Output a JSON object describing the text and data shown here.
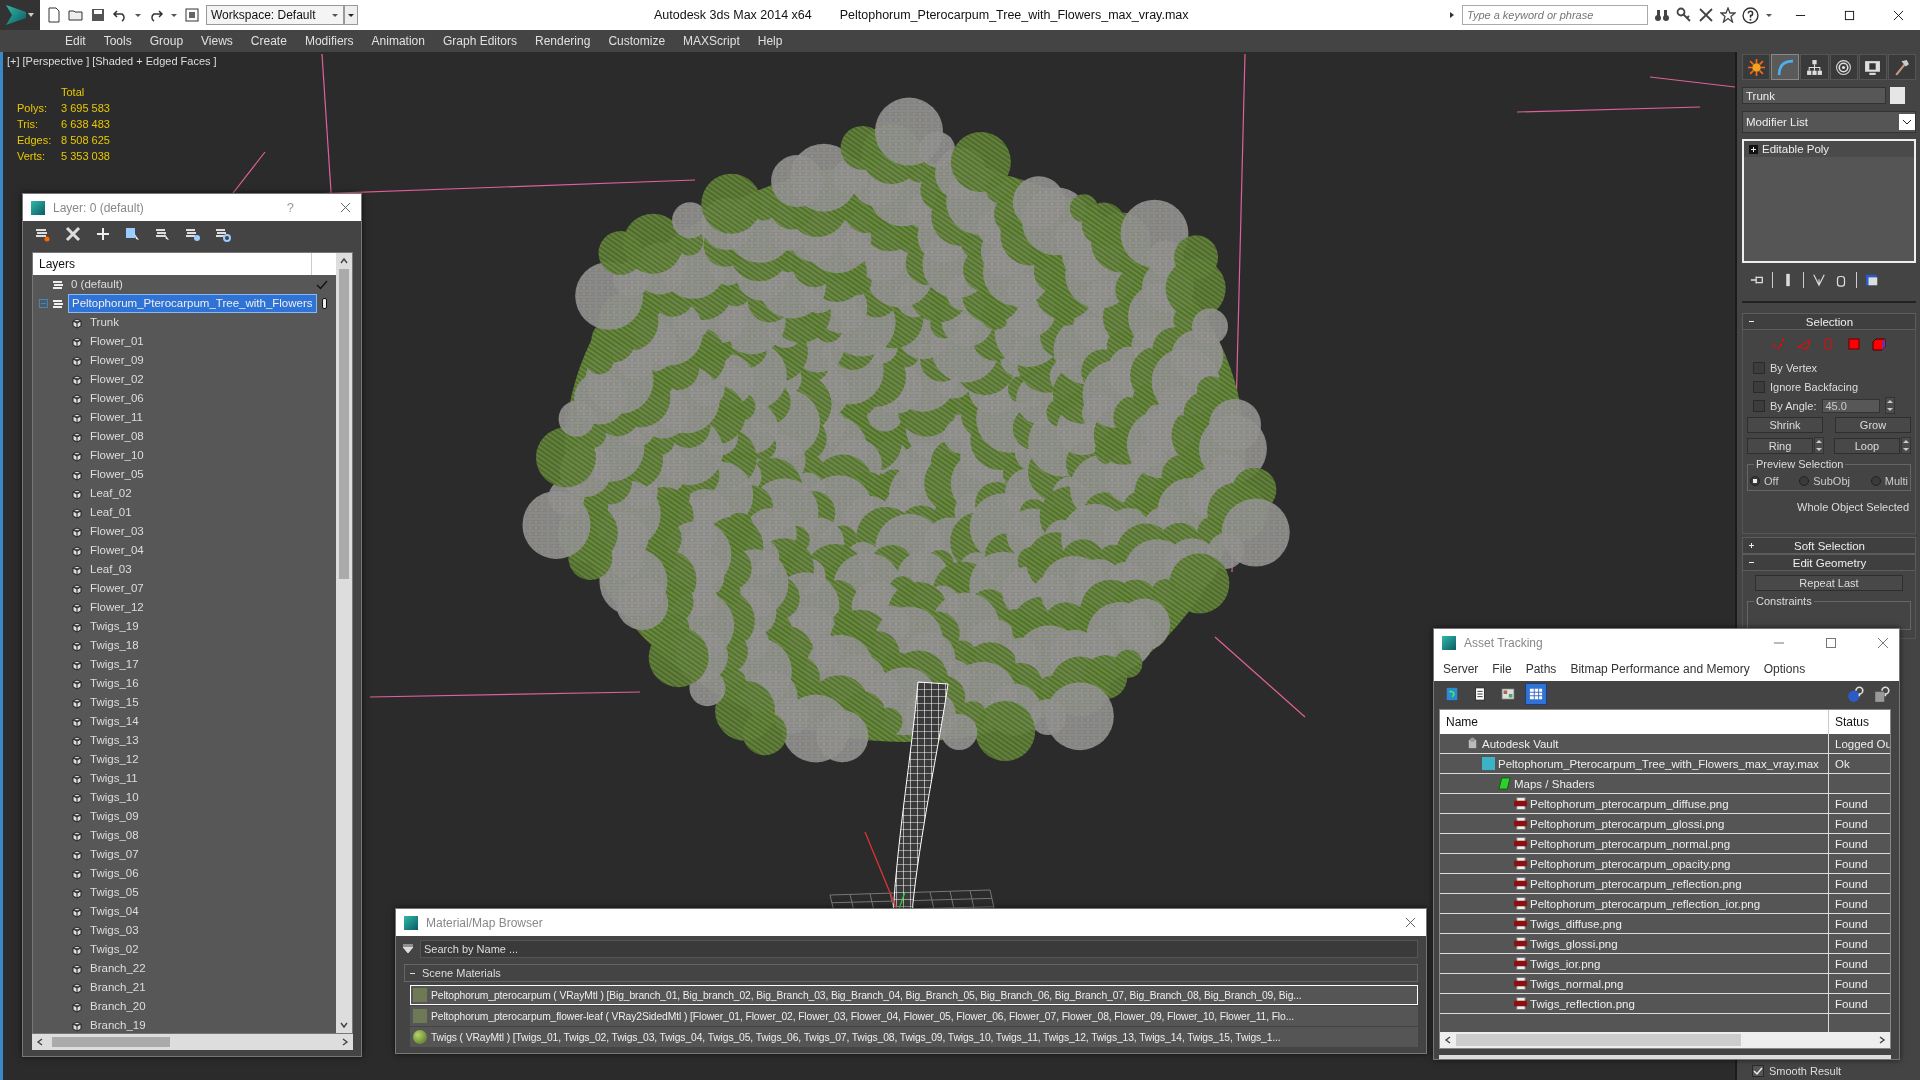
{
  "title_bar": {
    "workspace": "Workspace: Default",
    "app_title": "Autodesk 3ds Max  2014 x64",
    "file_name": "Peltophorum_Pterocarpum_Tree_with_Flowers_max_vray.max",
    "search": {
      "placeholder": "Type a keyword or phrase"
    }
  },
  "menu_bar": [
    "Edit",
    "Tools",
    "Group",
    "Views",
    "Create",
    "Modifiers",
    "Animation",
    "Graph Editors",
    "Rendering",
    "Customize",
    "MAXScript",
    "Help"
  ],
  "viewport": {
    "labels": [
      "[+]",
      "[Perspective ]",
      "[Shaded + Edged Faces ]"
    ],
    "stats": {
      "header": "Total",
      "rows": [
        {
          "label": "Polys:",
          "value": "3 695 583"
        },
        {
          "label": "Tris:",
          "value": "6 638 483"
        },
        {
          "label": "Edges:",
          "value": "8 508 625"
        },
        {
          "label": "Verts:",
          "value": "5 353 038"
        }
      ]
    }
  },
  "layer_dialog": {
    "title": "Layer: 0 (default)",
    "help": "?",
    "column": "Layers",
    "layers": [
      {
        "name": "0 (default)",
        "current": true,
        "selected": false
      },
      {
        "name": "Peltophorum_Pterocarpum_Tree_with_Flowers",
        "current": false,
        "selected": true,
        "expanded": true,
        "children": [
          {
            "name": "Trunk"
          },
          {
            "name": "Flower_01"
          },
          {
            "name": "Flower_09"
          },
          {
            "name": "Flower_02"
          },
          {
            "name": "Flower_06"
          },
          {
            "name": "Flower_11"
          },
          {
            "name": "Flower_08"
          },
          {
            "name": "Flower_10"
          },
          {
            "name": "Flower_05"
          },
          {
            "name": "Leaf_02"
          },
          {
            "name": "Leaf_01"
          },
          {
            "name": "Flower_03"
          },
          {
            "name": "Flower_04"
          },
          {
            "name": "Leaf_03"
          },
          {
            "name": "Flower_07"
          },
          {
            "name": "Flower_12"
          },
          {
            "name": "Twigs_19"
          },
          {
            "name": "Twigs_18"
          },
          {
            "name": "Twigs_17"
          },
          {
            "name": "Twigs_16"
          },
          {
            "name": "Twigs_15"
          },
          {
            "name": "Twigs_14"
          },
          {
            "name": "Twigs_13"
          },
          {
            "name": "Twigs_12"
          },
          {
            "name": "Twigs_11"
          },
          {
            "name": "Twigs_10"
          },
          {
            "name": "Twigs_09"
          },
          {
            "name": "Twigs_08"
          },
          {
            "name": "Twigs_07"
          },
          {
            "name": "Twigs_06"
          },
          {
            "name": "Twigs_05"
          },
          {
            "name": "Twigs_04"
          },
          {
            "name": "Twigs_03"
          },
          {
            "name": "Twigs_02"
          },
          {
            "name": "Branch_22"
          },
          {
            "name": "Branch_21"
          },
          {
            "name": "Branch_20"
          },
          {
            "name": "Branch_19"
          }
        ]
      }
    ]
  },
  "command_panel": {
    "tabs": [
      {
        "kind": "create",
        "selected": false
      },
      {
        "kind": "modify",
        "selected": true
      },
      {
        "kind": "hierarchy",
        "selected": false
      },
      {
        "kind": "motion",
        "selected": false
      },
      {
        "kind": "display",
        "selected": false
      },
      {
        "kind": "utilities",
        "selected": false
      }
    ],
    "object_name": "Trunk",
    "modifier_list": "Modifier List",
    "stack": [
      {
        "name": "Editable Poly",
        "expanded": false
      }
    ],
    "selection": {
      "title": "Selection",
      "expanded": true,
      "levels": [
        {
          "kind": "vertex",
          "selected": false
        },
        {
          "kind": "edge",
          "selected": false
        },
        {
          "kind": "border",
          "selected": false
        },
        {
          "kind": "polygon",
          "selected": false
        },
        {
          "kind": "element",
          "selected": false
        }
      ],
      "checkboxes": [
        {
          "kind": "plain",
          "label": "By Vertex",
          "checked": false
        },
        {
          "kind": "plain",
          "label": "Ignore Backfacing",
          "checked": false
        },
        {
          "kind": "angle",
          "label": "By Angle:",
          "checked": false,
          "value": "45.0"
        }
      ],
      "buttons": [
        "Shrink",
        "Grow"
      ],
      "spin_buttons": [
        "Ring",
        "Loop"
      ],
      "preview": {
        "title": "Preview Selection",
        "options": [
          {
            "label": "Off",
            "selected": true
          },
          {
            "label": "SubObj",
            "selected": false
          },
          {
            "label": "Multi",
            "selected": false
          }
        ]
      },
      "status": "Whole Object Selected"
    },
    "soft_selection": {
      "title": "Soft Selection",
      "expanded": false
    },
    "edit_geometry": {
      "title": "Edit Geometry",
      "expanded": true,
      "button": "Repeat Last",
      "group": "Constraints"
    },
    "smooth_result": {
      "label": "Smooth Result",
      "checked": true
    }
  },
  "material_browser": {
    "title": "Material/Map Browser",
    "search": {
      "placeholder": "Search by Name ..."
    },
    "group": {
      "title": "Scene Materials",
      "expanded": true
    },
    "materials": [
      {
        "text": "Peltophorum_pterocarpum  ( VRayMtl ) [Big_branch_01, Big_branch_02, Big_Branch_03, Big_Branch_04, Big_Branch_05, Big_Branch_06, Big_Branch_07, Big_Branch_08, Big_Branch_09, Big...",
        "selected": true
      },
      {
        "text": "Peltophorum_pterocarpum_flower-leaf  ( VRay2SidedMtl ) [Flower_01, Flower_02, Flower_03, Flower_04, Flower_05, Flower_06, Flower_07, Flower_08, Flower_09, Flower_10, Flower_11, Flo...",
        "selected": false
      },
      {
        "text": "Twigs  ( VRayMtl ) [Twigs_01, Twigs_02, Twigs_03, Twigs_04, Twigs_05, Twigs_06, Twigs_07, Twigs_08, Twigs_09, Twigs_10, Twigs_11, Twigs_12, Twigs_13, Twigs_14, Twigs_15, Twigs_1...",
        "selected": false
      }
    ]
  },
  "asset_tracking": {
    "title": "Asset Tracking",
    "menu": [
      "Server",
      "File",
      "Paths",
      "Bitmap Performance and Memory",
      "Options"
    ],
    "toolbar": [
      {
        "kind": "refresh",
        "selected": false
      },
      {
        "kind": "list",
        "selected": false
      },
      {
        "kind": "thumbnails",
        "selected": false
      },
      {
        "kind": "table",
        "selected": true
      }
    ],
    "columns": [
      "Name",
      "Status"
    ],
    "assets": [
      {
        "kind": "vault",
        "name": "Autodesk Vault",
        "status": "Logged Ou",
        "children": [
          {
            "kind": "max",
            "name": "Peltophorum_Pterocarpum_Tree_with_Flowers_max_vray.max",
            "status": "Ok",
            "children": [
              {
                "kind": "maps",
                "name": "Maps / Shaders",
                "children": [
                  {
                    "kind": "png",
                    "name": "Peltophorum_pterocarpum_diffuse.png",
                    "status": "Found"
                  },
                  {
                    "kind": "png",
                    "name": "Peltophorum_pterocarpum_glossi.png",
                    "status": "Found"
                  },
                  {
                    "kind": "png",
                    "name": "Peltophorum_pterocarpum_normal.png",
                    "status": "Found"
                  },
                  {
                    "kind": "png",
                    "name": "Peltophorum_pterocarpum_opacity.png",
                    "status": "Found"
                  },
                  {
                    "kind": "png",
                    "name": "Peltophorum_pterocarpum_reflection.png",
                    "status": "Found"
                  },
                  {
                    "kind": "png",
                    "name": "Peltophorum_pterocarpum_reflection_ior.png",
                    "status": "Found"
                  },
                  {
                    "kind": "png",
                    "name": "Twigs_diffuse.png",
                    "status": "Found"
                  },
                  {
                    "kind": "png",
                    "name": "Twigs_glossi.png",
                    "status": "Found"
                  },
                  {
                    "kind": "png",
                    "name": "Twigs_ior.png",
                    "status": "Found"
                  },
                  {
                    "kind": "png",
                    "name": "Twigs_normal.png",
                    "status": "Found"
                  },
                  {
                    "kind": "png",
                    "name": "Twigs_reflection.png",
                    "status": "Found"
                  }
                ]
              }
            ]
          }
        ]
      }
    ]
  }
}
